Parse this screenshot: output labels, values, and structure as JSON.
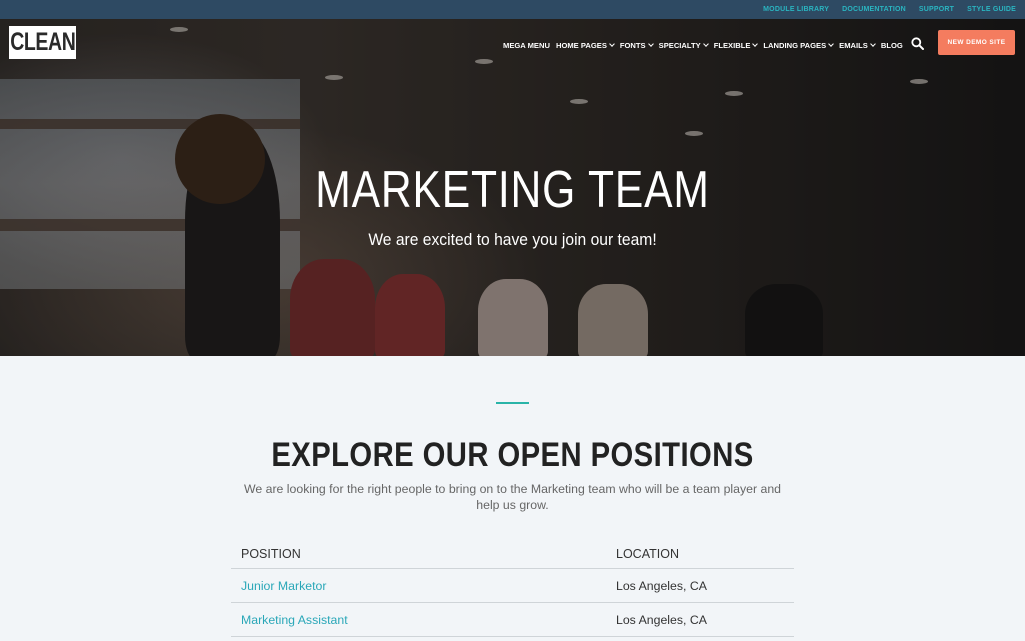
{
  "topbar": {
    "links": [
      "MODULE LIBRARY",
      "DOCUMENTATION",
      "SUPPORT",
      "STYLE GUIDE"
    ]
  },
  "header": {
    "logo_text": "CLEAN",
    "nav": [
      {
        "label": "MEGA MENU",
        "has_dropdown": false
      },
      {
        "label": "HOME PAGES",
        "has_dropdown": true
      },
      {
        "label": "FONTS",
        "has_dropdown": true
      },
      {
        "label": "SPECIALTY",
        "has_dropdown": true
      },
      {
        "label": "FLEXIBLE",
        "has_dropdown": true
      },
      {
        "label": "LANDING PAGES",
        "has_dropdown": true
      },
      {
        "label": "EMAILS",
        "has_dropdown": true
      },
      {
        "label": "BLOG",
        "has_dropdown": false
      }
    ],
    "search_icon": "search-icon",
    "cta_label": "NEW DEMO SITE"
  },
  "hero": {
    "title": "MARKETING TEAM",
    "subtitle": "We are excited to have you join our team!"
  },
  "positions": {
    "title": "EXPLORE OUR OPEN POSITIONS",
    "description": "We are looking for the right people to bring on to the Marketing team who will be a team player and help us grow.",
    "columns": [
      "POSITION",
      "LOCATION"
    ],
    "rows": [
      {
        "position": "Junior Marketor",
        "location": "Los Angeles, CA"
      },
      {
        "position": "Marketing Assistant",
        "location": "Los Angeles, CA"
      }
    ]
  },
  "colors": {
    "topbar_bg": "#2e4a63",
    "accent_teal": "#2ab4a8",
    "link_teal": "#2aa7b8",
    "cta_orange": "#f47c5f",
    "page_bg": "#f2f5f8"
  }
}
